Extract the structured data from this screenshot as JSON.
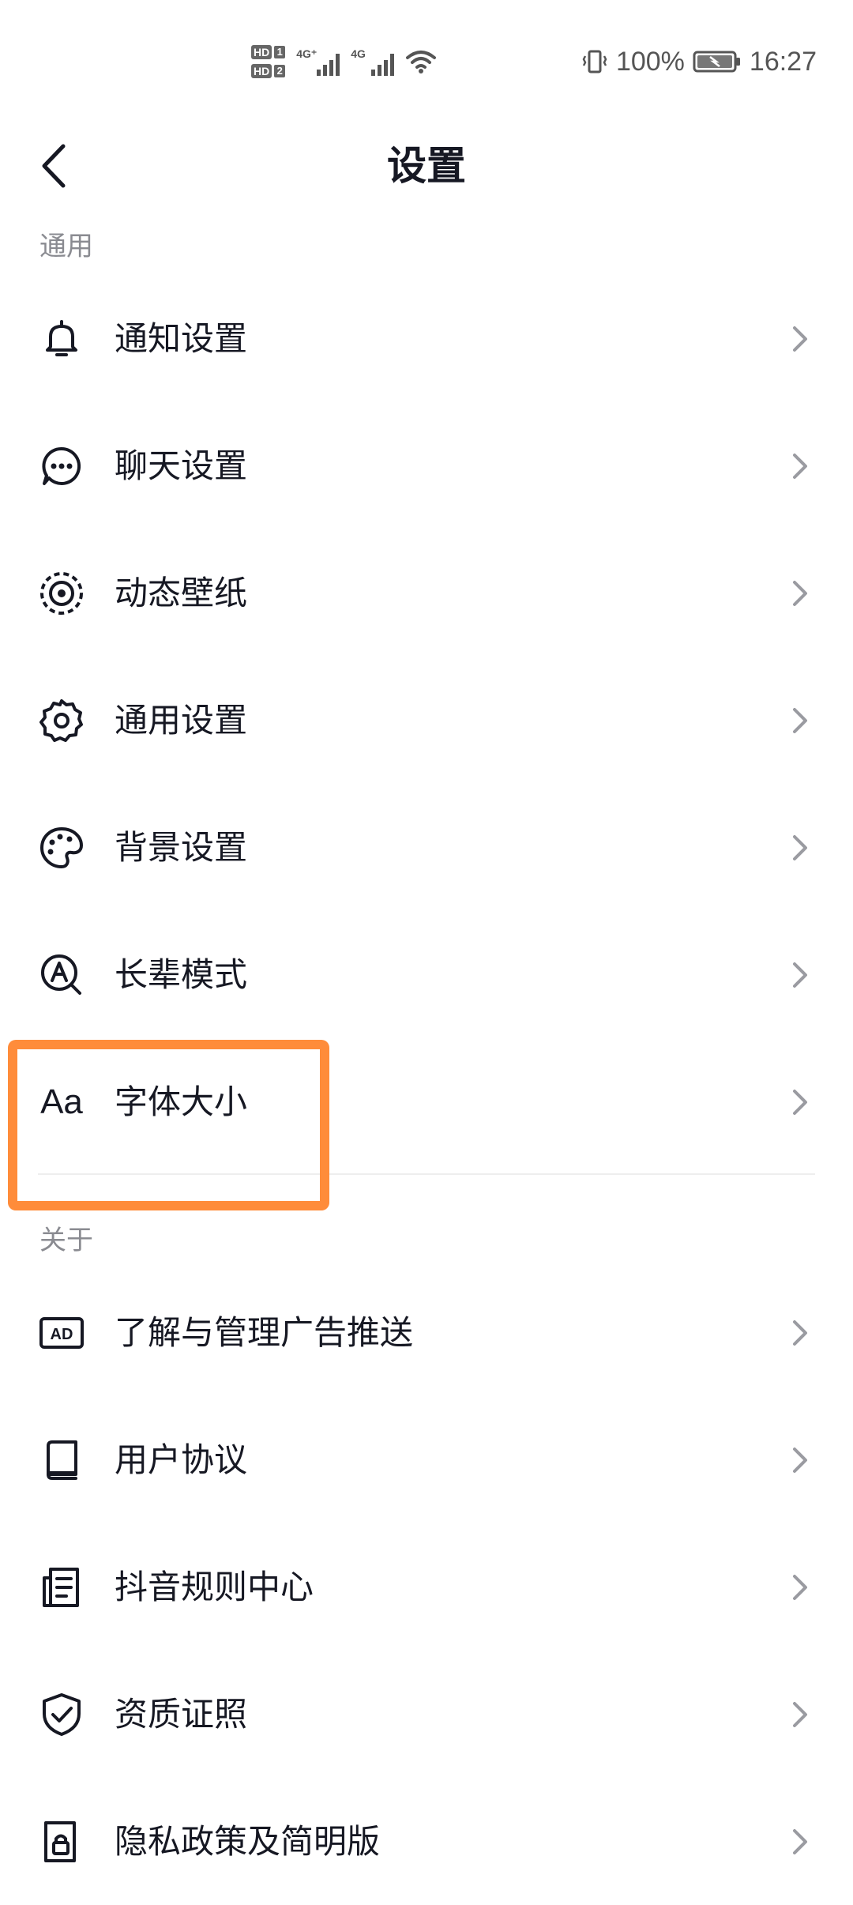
{
  "status_bar": {
    "battery": "100%",
    "time": "16:27",
    "sim1_badge": "HD",
    "sim1_num": "1",
    "sim2_badge": "HD",
    "sim2_num": "2",
    "net1": "4G⁺",
    "net2": "4G"
  },
  "header": {
    "title": "设置"
  },
  "sections": {
    "general": {
      "label": "通用",
      "items": [
        {
          "label": "通知设置",
          "icon": "bell-icon"
        },
        {
          "label": "聊天设置",
          "icon": "chat-bubble-icon"
        },
        {
          "label": "动态壁纸",
          "icon": "live-wallpaper-icon"
        },
        {
          "label": "通用设置",
          "icon": "gear-icon"
        },
        {
          "label": "背景设置",
          "icon": "palette-icon"
        },
        {
          "label": "长辈模式",
          "icon": "elder-mode-icon"
        },
        {
          "label": "字体大小",
          "icon": "font-size-icon",
          "icon_text": "Aa"
        }
      ]
    },
    "about": {
      "label": "关于",
      "items": [
        {
          "label": "了解与管理广告推送",
          "icon": "ad-icon",
          "icon_text": "AD"
        },
        {
          "label": "用户协议",
          "icon": "book-icon"
        },
        {
          "label": "抖音规则中心",
          "icon": "document-list-icon"
        },
        {
          "label": "资质证照",
          "icon": "shield-check-icon"
        },
        {
          "label": "隐私政策及简明版",
          "icon": "privacy-lock-icon"
        }
      ]
    }
  },
  "colors": {
    "highlight": "#ff8c3a",
    "text_primary": "#161823",
    "text_secondary": "#8a8b91",
    "chevron": "#9a9ba1"
  }
}
